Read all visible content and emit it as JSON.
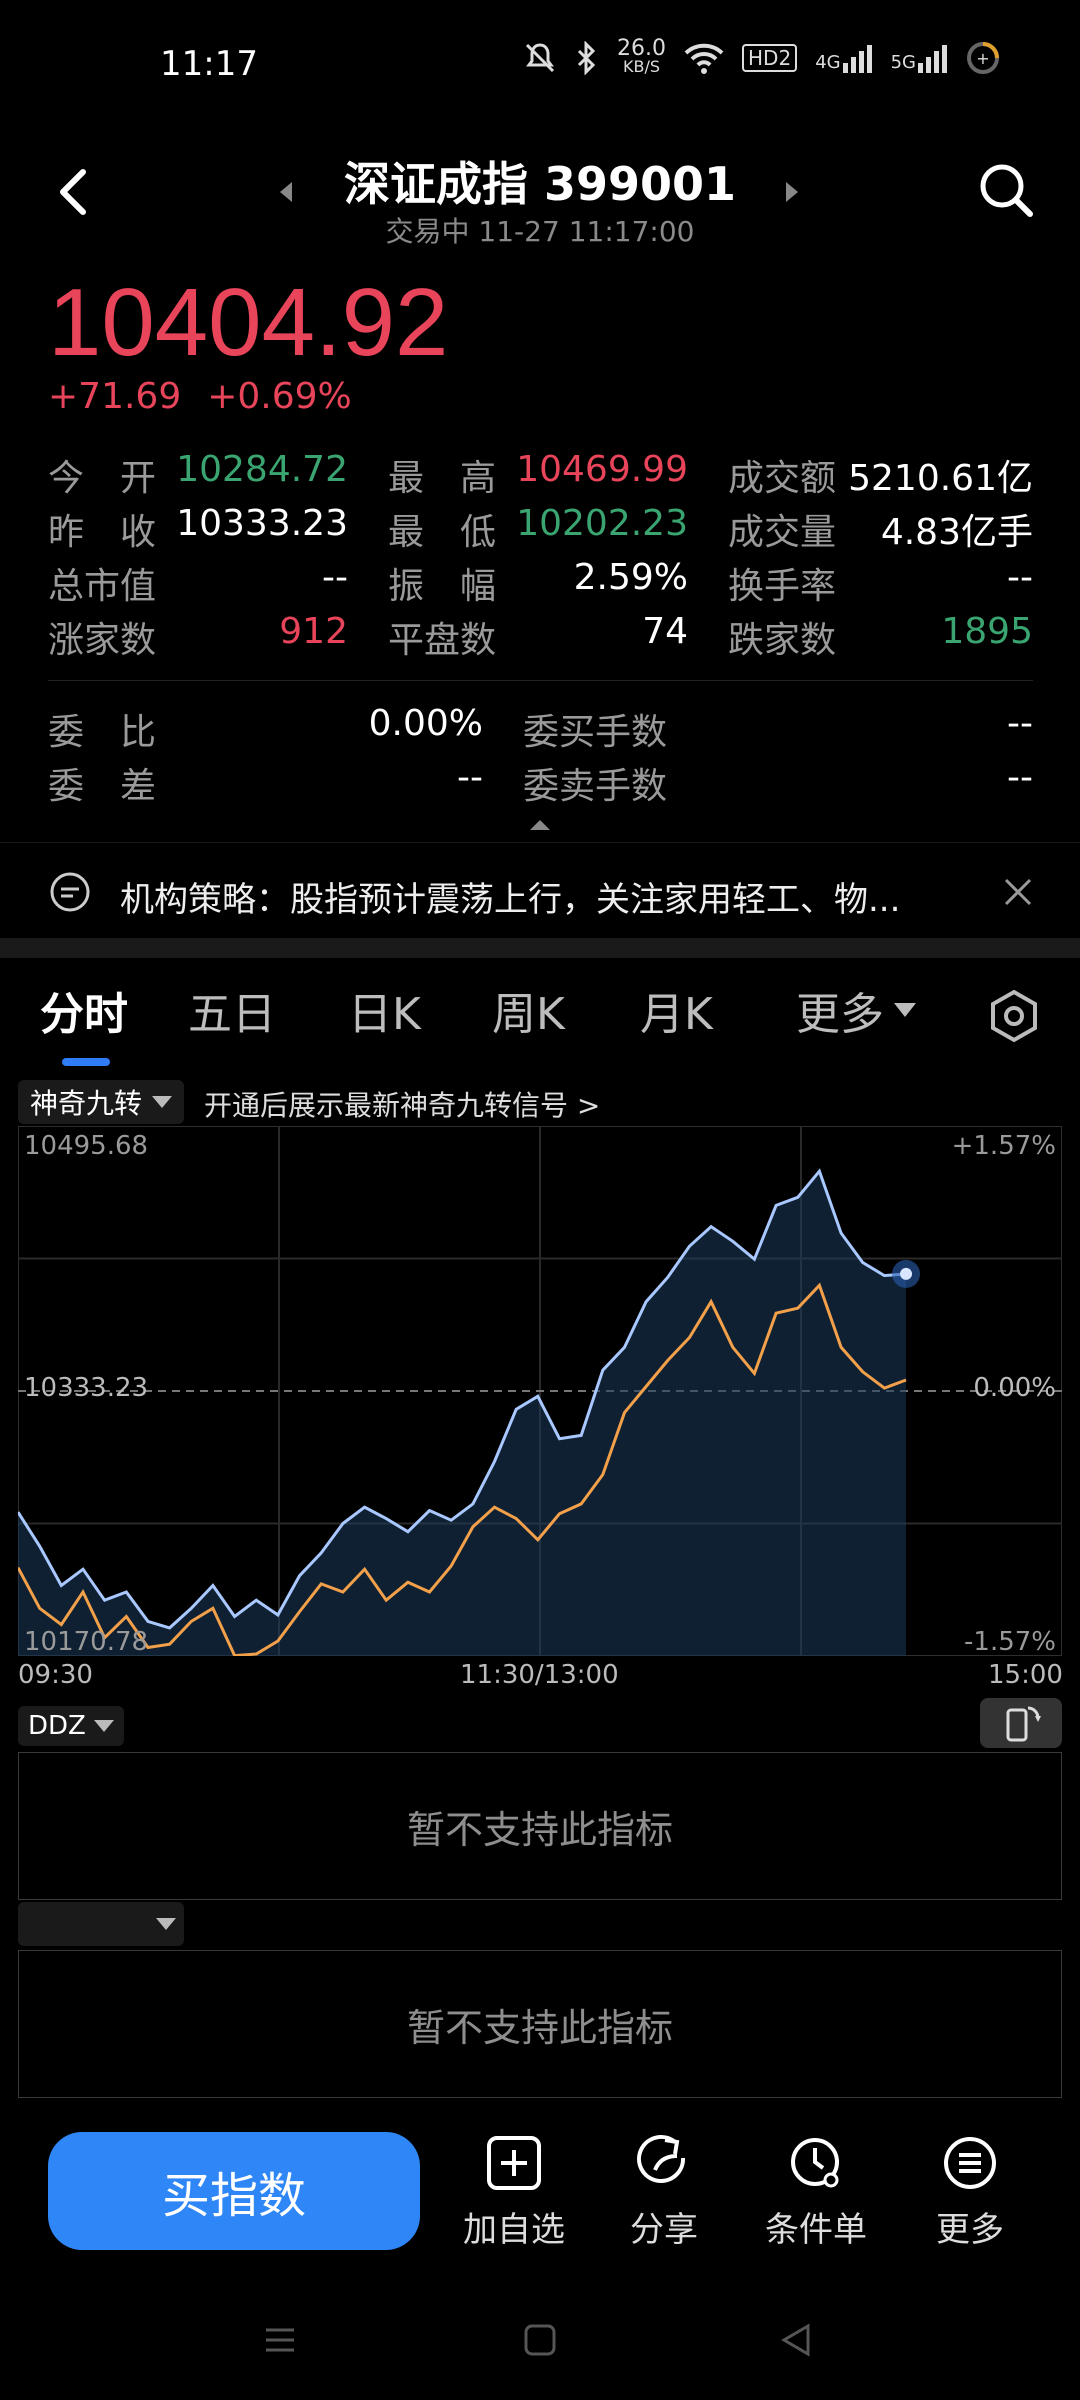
{
  "status_bar": {
    "time": "11:17",
    "net_speed": "26.0",
    "net_unit": "KB/S",
    "hd_badge": "HD2",
    "sig1": "4G",
    "sig2": "5G"
  },
  "header": {
    "title": "深证成指 399001",
    "subtitle": "交易中 11-27 11:17:00"
  },
  "quote": {
    "price": "10404.92",
    "change": "+71.69",
    "change_pct": "+0.69%"
  },
  "stats": [
    [
      {
        "label": "今　开",
        "value": "10284.72",
        "color": "g"
      },
      {
        "label": "最　高",
        "value": "10469.99",
        "color": "r"
      },
      {
        "label": "成交额",
        "value": "5210.61亿",
        "color": "w"
      }
    ],
    [
      {
        "label": "昨　收",
        "value": "10333.23",
        "color": "w"
      },
      {
        "label": "最　低",
        "value": "10202.23",
        "color": "g"
      },
      {
        "label": "成交量",
        "value": "4.83亿手",
        "color": "w"
      }
    ],
    [
      {
        "label": "总市值",
        "value": "--",
        "color": "w"
      },
      {
        "label": "振　幅",
        "value": "2.59%",
        "color": "w"
      },
      {
        "label": "换手率",
        "value": "--",
        "color": "w"
      }
    ],
    [
      {
        "label": "涨家数",
        "value": "912",
        "color": "r"
      },
      {
        "label": "平盘数",
        "value": "74",
        "color": "w"
      },
      {
        "label": "跌家数",
        "value": "1895",
        "color": "g"
      }
    ]
  ],
  "stats2": [
    [
      {
        "label": "委　比",
        "value": "0.00%"
      },
      {
        "label": "委买手数",
        "value": "--"
      }
    ],
    [
      {
        "label": "委　差",
        "value": "--"
      },
      {
        "label": "委卖手数",
        "value": "--"
      }
    ]
  ],
  "news": {
    "text": "机构策略：股指预计震荡上行，关注家用轻工、物..."
  },
  "tabs": [
    {
      "label": "分时"
    },
    {
      "label": "五日"
    },
    {
      "label": "日K"
    },
    {
      "label": "周K"
    },
    {
      "label": "月K"
    },
    {
      "label": "更多"
    }
  ],
  "indicator": {
    "name": "神奇九转",
    "hint": "开通后展示最新神奇九转信号 >"
  },
  "chart_data": {
    "type": "line",
    "y_max_label": "10495.68",
    "y_mid_label": "10333.23",
    "y_min_label": "10170.78",
    "pct_max_label": "+1.57%",
    "pct_mid_label": "0.00%",
    "pct_min_label": "-1.57%",
    "x_labels": [
      "09:30",
      "11:30/13:00",
      "15:00"
    ],
    "ylim": [
      10170.78,
      10495.68
    ],
    "prev_close": 10333.23,
    "grid": true,
    "series": [
      {
        "values": [
          10259,
          10238,
          10214,
          10224,
          10205,
          10210,
          10192,
          10188,
          10200,
          10214,
          10195,
          10205,
          10196,
          10220,
          10234,
          10252,
          10262,
          10255,
          10247,
          10260,
          10254,
          10264,
          10290,
          10322,
          10330,
          10304,
          10306,
          10346,
          10360,
          10388,
          10403,
          10422,
          10434,
          10425,
          10414,
          10447,
          10452,
          10468,
          10430,
          10412,
          10404,
          10405
        ],
        "color": "#a9c8ff"
      },
      {
        "values": [
          10225,
          10200,
          10190,
          10210,
          10182,
          10195,
          10176,
          10178,
          10192,
          10200,
          10171,
          10172,
          10180,
          10198,
          10215,
          10210,
          10224,
          10205,
          10216,
          10210,
          10226,
          10250,
          10262,
          10255,
          10242,
          10258,
          10264,
          10282,
          10320,
          10336,
          10352,
          10366,
          10388,
          10360,
          10344,
          10381,
          10384,
          10398,
          10360,
          10345,
          10335,
          10340
        ],
        "color": "#f3a04a"
      }
    ]
  },
  "ddz": {
    "name": "DDZ",
    "unsupported": "暂不支持此指标"
  },
  "panel2": {
    "unsupported": "暂不支持此指标"
  },
  "bottom": {
    "buy": "买指数",
    "add": "加自选",
    "share": "分享",
    "condition": "条件单",
    "more": "更多"
  }
}
